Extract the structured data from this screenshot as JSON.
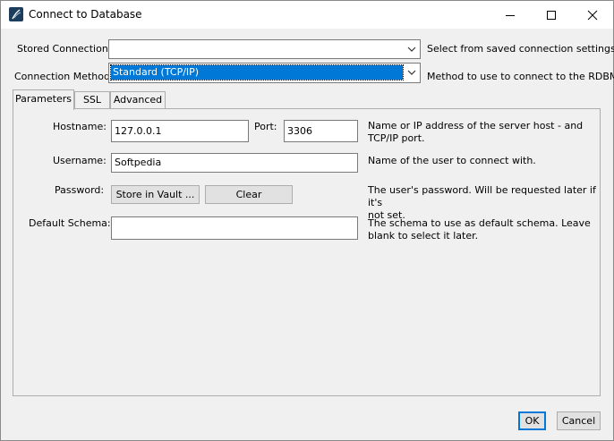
{
  "window": {
    "title": "Connect to Database"
  },
  "top": {
    "stored_connection_label": "Stored Connection:",
    "stored_connection_value": "",
    "stored_connection_desc": "Select from saved connection settings",
    "connection_method_label": "Connection Method:",
    "connection_method_value": "Standard (TCP/IP)",
    "connection_method_desc": "Method to use to connect to the RDBMS"
  },
  "tabs": [
    {
      "label": "Parameters"
    },
    {
      "label": "SSL"
    },
    {
      "label": "Advanced"
    }
  ],
  "params": {
    "hostname_label": "Hostname:",
    "hostname_value": "127.0.0.1",
    "port_label": "Port:",
    "port_value": "3306",
    "hostname_desc_1": "Name or IP address of the server host - and",
    "hostname_desc_2": "TCP/IP port.",
    "username_label": "Username:",
    "username_value": "Softpedia",
    "username_desc": "Name of the user to connect with.",
    "password_label": "Password:",
    "store_vault_label": "Store in Vault ...",
    "clear_label": "Clear",
    "password_desc_1": "The user's password. Will be requested later if it's",
    "password_desc_2": "not set.",
    "schema_label": "Default Schema:",
    "schema_value": "",
    "schema_desc_1": "The schema to use as default schema. Leave",
    "schema_desc_2": "blank to select it later."
  },
  "footer": {
    "ok_label": "OK",
    "cancel_label": "Cancel"
  },
  "colors": {
    "selection": "#0078d7",
    "window_bg": "#f0f0f0"
  }
}
